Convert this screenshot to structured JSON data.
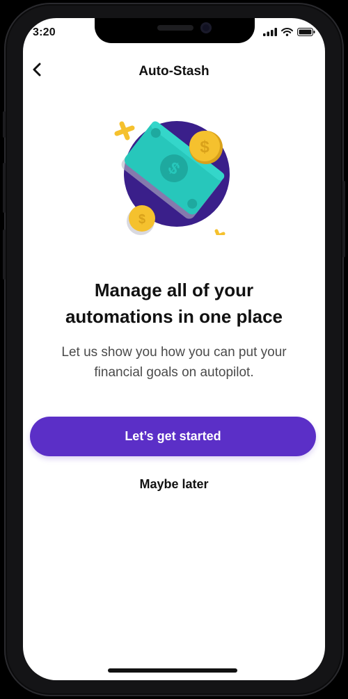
{
  "status_bar": {
    "time": "3:20"
  },
  "header": {
    "title": "Auto-Stash"
  },
  "hero": {
    "headline_line1": "Manage all of your",
    "headline_line2": "automations in one place",
    "subtext_line1": "Let us show you how you can put your",
    "subtext_line2": "financial goals on autopilot."
  },
  "actions": {
    "primary_label": "Let’s get started",
    "secondary_label": "Maybe later"
  },
  "colors": {
    "accent": "#5b2fc7",
    "illustration_circle": "#3a1f8a",
    "bill": "#25c4b8",
    "coin": "#f5c12e"
  },
  "icons": {
    "back": "chevron-left-icon",
    "illustration": "money-stash-illustration"
  }
}
